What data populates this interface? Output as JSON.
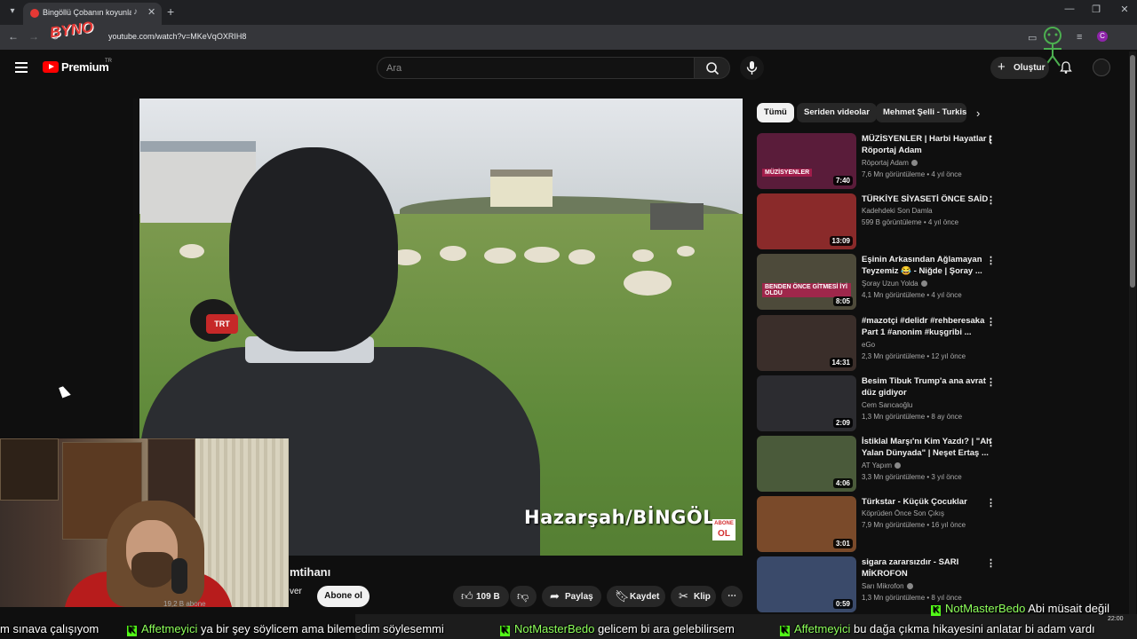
{
  "browser": {
    "tab_title": "Bingöllü Çobanın koyunları",
    "url": "youtube.com/watch?v=MKeVqOXRIH8",
    "overlay_logo": "BYNO",
    "profile_initial": "C"
  },
  "header": {
    "brand": "Premium",
    "region": "TR",
    "search_placeholder": "Ara",
    "create_label": "Oluştur"
  },
  "video": {
    "caption": "Hazarşah/BİNGÖL",
    "mic_badge": "TRT",
    "corner_badge_line1": "ABONE",
    "corner_badge_line2": "OL",
    "title_partial": "mtihanı",
    "channel_partial": "ver",
    "subscribers": "19,2 B abone",
    "subscribe_label": "Abone ol"
  },
  "actions": {
    "likes": "109 B",
    "share": "Paylaş",
    "save": "Kaydet",
    "clip": "Klip",
    "more": "⋯"
  },
  "chips": [
    "Tümü",
    "Seriden videolar",
    "Mehmet Şelli - Turkist"
  ],
  "recommendations": [
    {
      "title": "MÜZİSYENLER | Harbi Hayatlar | Röportaj Adam",
      "channel": "Röportaj Adam",
      "verified": true,
      "views": "7,6 Mn görüntüleme",
      "age": "4 yıl önce",
      "duration": "7:40",
      "thumb_color": "#5a1c3a",
      "thumb_label": "MÜZİSYENLER"
    },
    {
      "title": "TÜRKİYE SİYASETİ ÖNCE SAİD",
      "channel": "Kadehdeki Son Damla",
      "verified": false,
      "views": "599 B görüntüleme",
      "age": "4 yıl önce",
      "duration": "13:09",
      "thumb_color": "#8a2a2a",
      "thumb_label": ""
    },
    {
      "title": "Eşinin Arkasından Ağlamayan Teyzemiz 😂 - Niğde | Şoray ...",
      "channel": "Şoray Uzun Yolda",
      "verified": true,
      "views": "4,1 Mn görüntüleme",
      "age": "4 yıl önce",
      "duration": "8:05",
      "thumb_color": "#4d4a3a",
      "thumb_label": "BENDEN ÖNCE GİTMESİ İYİ OLDU"
    },
    {
      "title": "#mazotçi #delidr #rehberesaka Part 1 #anonim #kuşgribi ...",
      "channel": "eGo",
      "verified": false,
      "views": "2,3 Mn görüntüleme",
      "age": "12 yıl önce",
      "duration": "14:31",
      "thumb_color": "#3a2e2a",
      "thumb_label": ""
    },
    {
      "title": "Besim Tibuk Trump'a ana avrat düz gidiyor",
      "channel": "Cem Sarıcaoğlu",
      "verified": false,
      "views": "1,3 Mn görüntüleme",
      "age": "8 ay önce",
      "duration": "2:09",
      "thumb_color": "#2c2c30",
      "thumb_label": ""
    },
    {
      "title": "İstiklal Marşı'nı Kim Yazdı? | \"Ah Yalan Dünyada\" | Neşet Ertaş ...",
      "channel": "AT Yapım",
      "verified": true,
      "views": "3,3 Mn görüntüleme",
      "age": "3 yıl önce",
      "duration": "4:06",
      "thumb_color": "#4a5a3a",
      "thumb_label": ""
    },
    {
      "title": "Türkstar - Küçük Çocuklar",
      "channel": "Köprüden Önce Son Çıkış",
      "verified": false,
      "views": "7,9 Mn görüntüleme",
      "age": "16 yıl önce",
      "duration": "3:01",
      "thumb_color": "#7a4a2a",
      "thumb_label": ""
    },
    {
      "title": "sigara zararsızdır - SARI MİKROFON",
      "channel": "Sarı Mikrofon",
      "verified": true,
      "views": "1,3 Mn görüntüleme",
      "age": "8 yıl önce",
      "duration": "0:59",
      "thumb_color": "#3a4a6a",
      "thumb_label": ""
    }
  ],
  "ticker": {
    "segment0": "m sınava çalışıyom",
    "user1": "Affetmeyici",
    "msg1": "ya bir şey söylicem ama bilemedim söylesemmi",
    "user2": "NotMasterBedo",
    "msg2": "gelicem bi ara gelebilirsem",
    "user3": "Affetmeyici",
    "msg3": "bu dağa çıkma hikayesini anlatar bi adam vardı",
    "top_user": "NotMasterBedo",
    "top_msg": "Abi müsait değil",
    "clock": "22:00"
  },
  "colors": {
    "youtube_red": "#ff0000",
    "kick_green": "#53fc18",
    "background": "#0f0f0f"
  }
}
